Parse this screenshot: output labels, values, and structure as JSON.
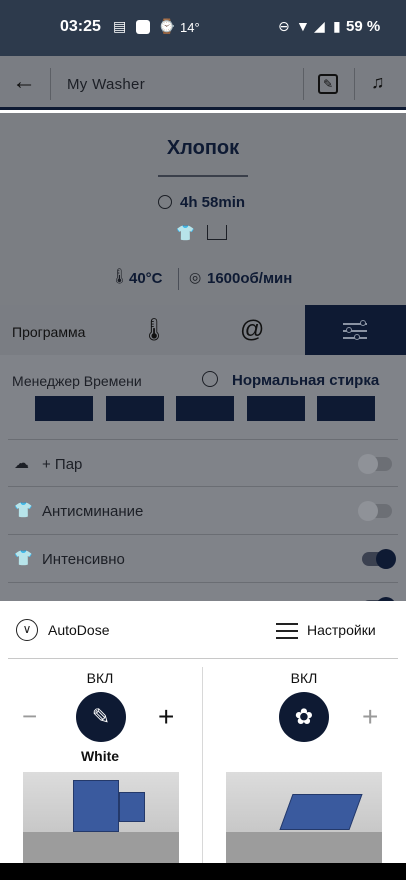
{
  "status_bar": {
    "time": "03:25",
    "temperature": "14°",
    "battery": "59 %"
  },
  "app_bar": {
    "title": "My Washer"
  },
  "program": {
    "name": "Хлопок",
    "duration": "4h 58min",
    "temperature": "40°C",
    "spin": "1600об/мин"
  },
  "tabs": {
    "program_label": "Программа",
    "active_tab": "settings"
  },
  "time_manager": {
    "label": "Менеджер Времени",
    "mode": "Нормальная стирка",
    "segments": 5,
    "selected_segments": 5
  },
  "options": [
    {
      "label": "+ Пар",
      "icon": "steam-icon",
      "enabled": false
    },
    {
      "label": "Антисминание",
      "icon": "shirt-icon",
      "enabled": false
    },
    {
      "label": "Интенсивно",
      "icon": "shirt-icon",
      "enabled": true
    },
    {
      "label": "",
      "icon": "basket-icon",
      "enabled": true
    }
  ],
  "sheet": {
    "autodose_label": "AutoDose",
    "settings_label": "Настройки",
    "left": {
      "state": "ВКЛ",
      "detergent": "White"
    },
    "right": {
      "state": "ВКЛ"
    }
  },
  "colors": {
    "navy": "#0e1a33",
    "overlay": "#7a7d83",
    "status_bar": "#2d3a4c"
  }
}
